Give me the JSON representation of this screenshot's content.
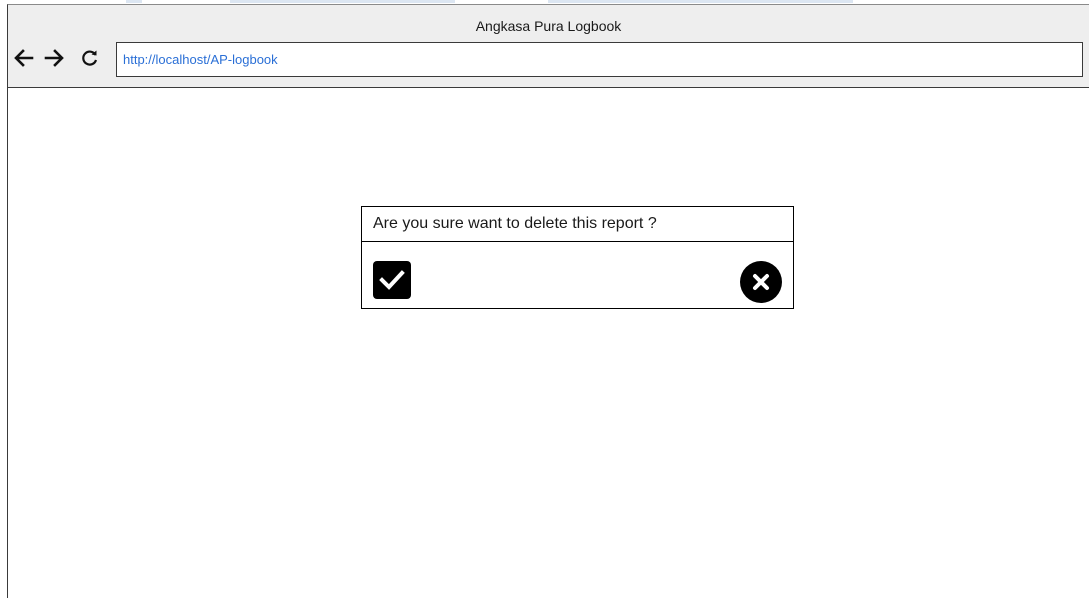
{
  "window": {
    "title": "Angkasa Pura Logbook"
  },
  "toolbar": {
    "back_icon": "arrow-left-icon",
    "forward_icon": "arrow-right-icon",
    "reload_icon": "reload-icon",
    "url": "http://localhost/AP-logbook"
  },
  "dialog": {
    "message": "Are you sure want to delete this report ?",
    "confirm_icon": "checkmark-icon",
    "cancel_icon": "close-circle-icon"
  },
  "colors": {
    "url_text": "#2a6fd6",
    "chrome_bg": "#eeeeee",
    "border": "#3a3a3a",
    "button_fill": "#000000"
  }
}
